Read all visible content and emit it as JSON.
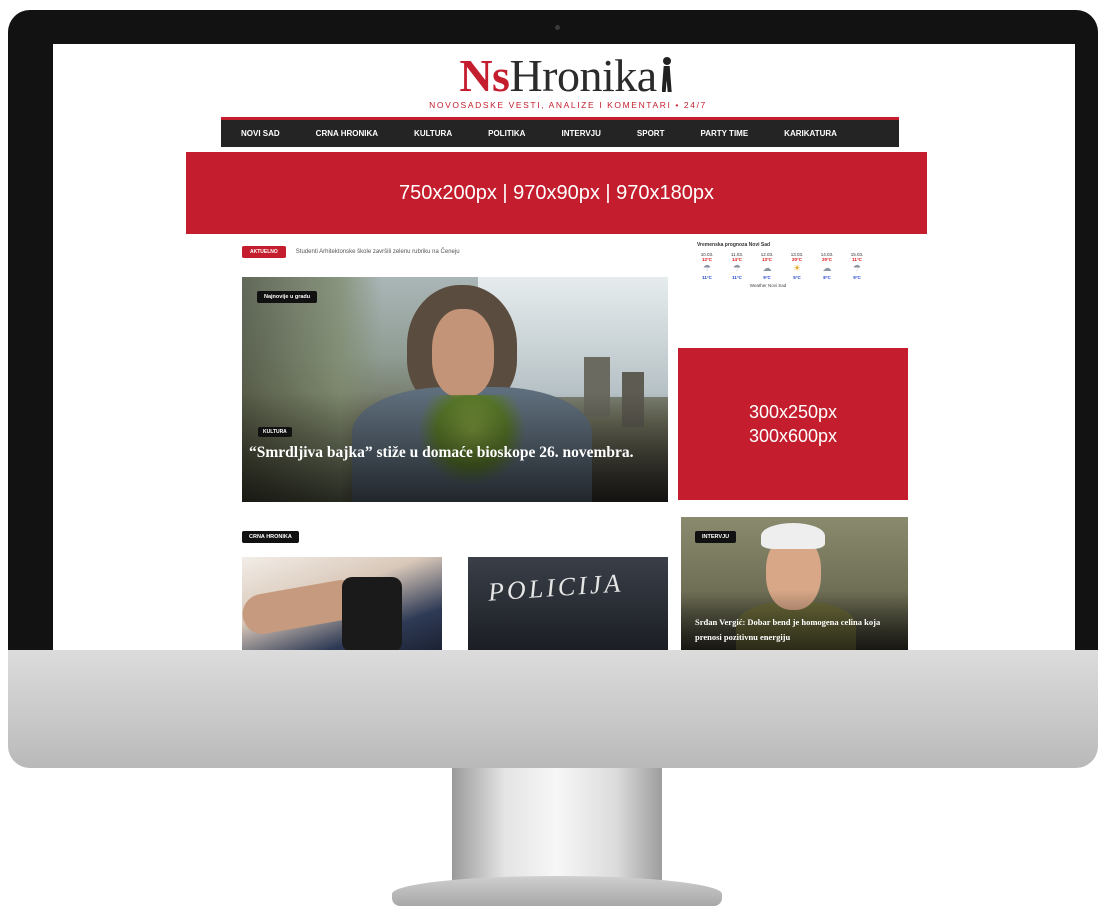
{
  "site": {
    "logo_prefix": "Ns",
    "logo_main": "Hronika",
    "tagline": "NOVOSADSKE VESTI, ANALIZE I KOMENTARI • 24/7"
  },
  "nav": {
    "items": [
      "NOVI SAD",
      "CRNA HRONIKA",
      "KULTURA",
      "POLITIKA",
      "INTERVJU",
      "SPORT",
      "PARTY TIME",
      "KARIKATURA"
    ]
  },
  "ads": {
    "leaderboard": "750x200px | 970x90px | 970x180px",
    "rectangle_line1": "300x250px",
    "rectangle_line2": "300x600px"
  },
  "ticker": {
    "badge": "AKTUELNO",
    "text": "Studenti Arhitektonske škole završili zelenu rubriku na Čeneju"
  },
  "hero": {
    "badge": "Najnovije u gradu",
    "category": "KULTURA",
    "title": "“Smrdljiva bajka” stiže u domaće bioskope 26. novembra."
  },
  "weather": {
    "title": "Vremenska prognoza Novi Sad",
    "days": [
      {
        "date": "10.03.",
        "max": "12°C",
        "min": "11°C",
        "icon": "rain-icon"
      },
      {
        "date": "11.03.",
        "max": "14°C",
        "min": "11°C",
        "icon": "rain-icon"
      },
      {
        "date": "12.03.",
        "max": "13°C",
        "min": "9°C",
        "icon": "cloud-icon"
      },
      {
        "date": "13.03.",
        "max": "20°C",
        "min": "5°C",
        "icon": "sun-cloud-icon"
      },
      {
        "date": "14.03.",
        "max": "20°C",
        "min": "8°C",
        "icon": "cloud-icon"
      },
      {
        "date": "15.03.",
        "max": "11°C",
        "min": "9°C",
        "icon": "rain-icon"
      }
    ],
    "credit": "Weather Novi Sad"
  },
  "sections": {
    "crna_hronika_badge": "CRNA HRONIKA",
    "policija_text": "POLICIJA",
    "interview_badge": "INTERVJU",
    "interview_title": "Srđan Vergić: Dobar bend je homogena celina koja prenosi pozitivnu energiju"
  },
  "colors": {
    "brand_red": "#c41e2e",
    "nav_dark": "#242424"
  }
}
